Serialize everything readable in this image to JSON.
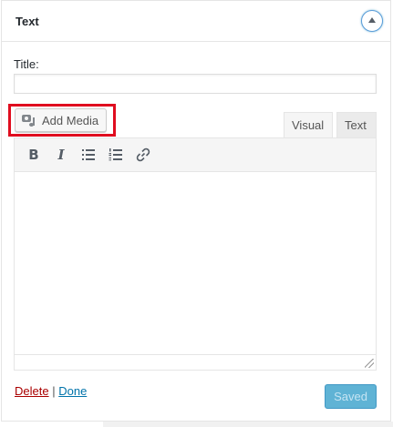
{
  "widget": {
    "title": "Text",
    "toggle_icon": "arrow-up-icon"
  },
  "form": {
    "title_label": "Title:",
    "title_value": "",
    "add_media_label": "Add Media",
    "tabs": [
      "Visual",
      "Text"
    ],
    "active_tab": "Visual"
  },
  "toolbar": {
    "buttons": [
      {
        "name": "bold",
        "glyph": "B"
      },
      {
        "name": "italic",
        "glyph": "I"
      },
      {
        "name": "bullet-list",
        "icon": "bullet-list-icon"
      },
      {
        "name": "numbered-list",
        "icon": "numbered-list-icon"
      },
      {
        "name": "link",
        "icon": "link-icon"
      }
    ]
  },
  "footer": {
    "delete_label": "Delete",
    "separator": "|",
    "done_label": "Done",
    "saved_label": "Saved"
  },
  "colors": {
    "delete": "#aa0000",
    "done": "#0073aa",
    "saved_button": "#4eabd1",
    "highlight": "#e00d1f"
  }
}
